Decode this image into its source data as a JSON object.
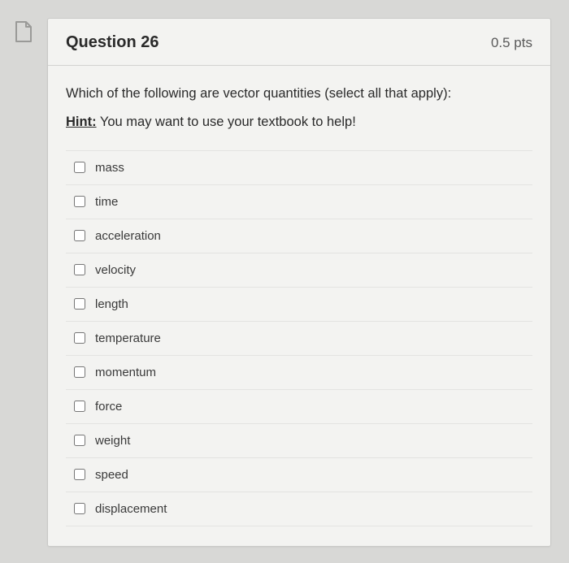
{
  "header": {
    "title": "Question 26",
    "points": "0.5 pts"
  },
  "prompt": "Which of the following are vector quantities (select all that apply):",
  "hint_label": "Hint:",
  "hint_text": " You may want to use your textbook to help!",
  "options": [
    {
      "label": "mass"
    },
    {
      "label": "time"
    },
    {
      "label": "acceleration"
    },
    {
      "label": "velocity"
    },
    {
      "label": "length"
    },
    {
      "label": "temperature"
    },
    {
      "label": "momentum"
    },
    {
      "label": "force"
    },
    {
      "label": "weight"
    },
    {
      "label": "speed"
    },
    {
      "label": "displacement"
    }
  ]
}
